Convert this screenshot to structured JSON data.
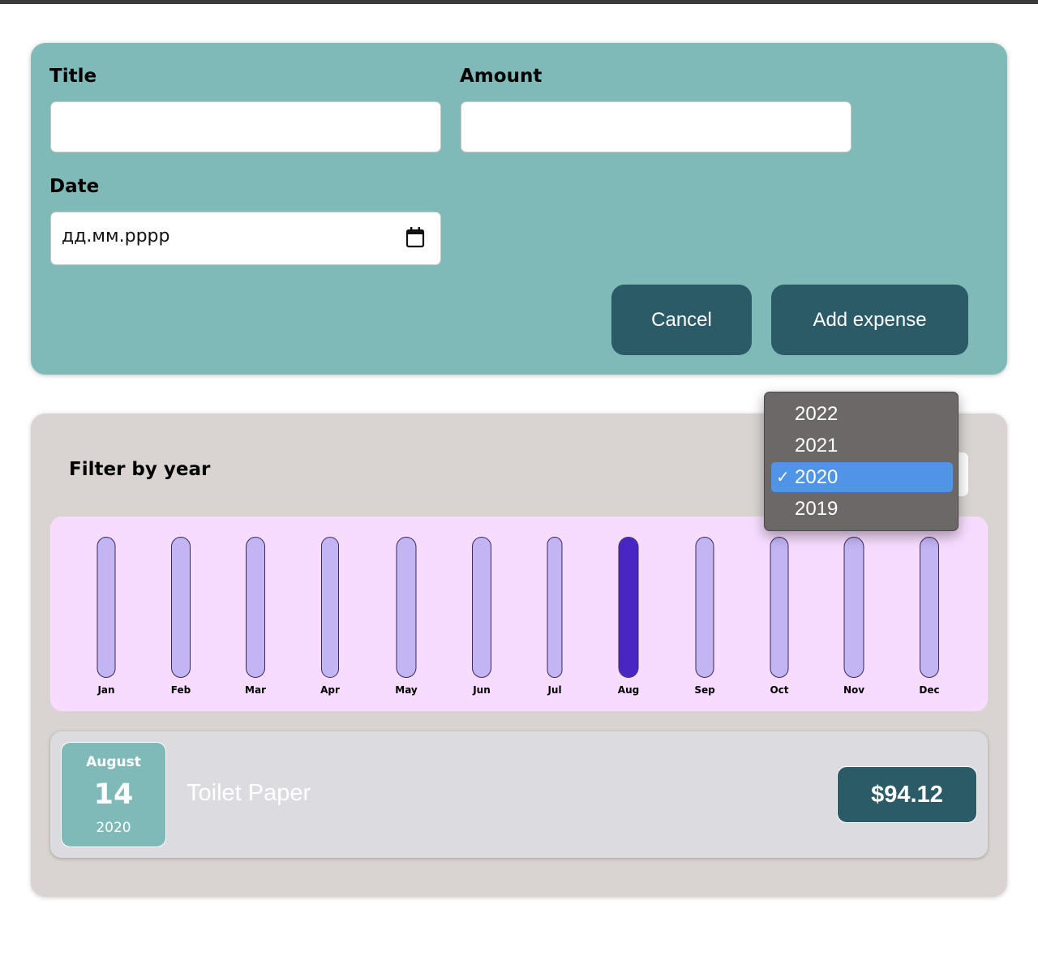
{
  "form": {
    "title_label": "Title",
    "title_value": "",
    "amount_label": "Amount",
    "amount_value": "",
    "date_label": "Date",
    "date_placeholder": "дд.мм.рррр",
    "cancel_label": "Cancel",
    "add_label": "Add expense"
  },
  "filter": {
    "label": "Filter by year",
    "selected_year": "2020",
    "options": [
      "2022",
      "2021",
      "2020",
      "2019"
    ]
  },
  "chart_data": {
    "type": "bar",
    "categories": [
      "Jan",
      "Feb",
      "Mar",
      "Apr",
      "May",
      "Jun",
      "Jul",
      "Aug",
      "Sep",
      "Oct",
      "Nov",
      "Dec"
    ],
    "values": [
      0,
      0,
      0,
      0,
      0,
      0,
      0,
      94.12,
      0,
      0,
      0,
      0
    ],
    "max_value": 94.12
  },
  "expenses": [
    {
      "month": "August",
      "day": "14",
      "year": "2020",
      "title": "Toilet Paper",
      "amount": "$94.12"
    }
  ],
  "colors": {
    "form_bg": "#7fbab8",
    "button_bg": "#2a5b67",
    "card_bg": "#d9d4d1",
    "chart_bg": "#f7dcff",
    "bar_empty": "#c3b4f3",
    "bar_fill": "#4826c4",
    "dropdown_selected": "#4f94e6"
  }
}
